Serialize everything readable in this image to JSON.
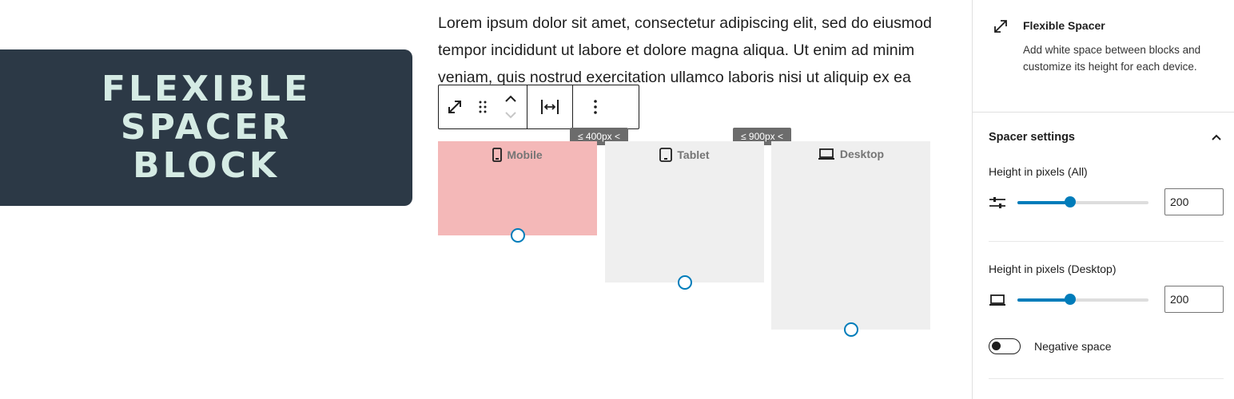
{
  "banner": {
    "title": "FLEXIBLE SPACER BLOCK"
  },
  "paragraph": {
    "text": "Lorem ipsum dolor sit amet, consectetur adipiscing elit, sed do eiusmod tempor incididunt ut labore et dolore magna aliqua. Ut enim ad minim veniam, quis nostrud exercitation ullamco laboris nisi ut aliquip ex ea commodo consequat."
  },
  "toolbar": {
    "buttons": [
      "resize-icon",
      "drag-handle-icon",
      "move-up-icon",
      "move-down-icon",
      "justify-icon",
      "more-options-icon"
    ]
  },
  "breakpoints": {
    "mobile": "≤ 400px <",
    "tablet": "≤ 900px <"
  },
  "previews": {
    "mobile": {
      "label": "Mobile",
      "icon": "mobile-icon",
      "color": "#f4b8b8"
    },
    "tablet": {
      "label": "Tablet",
      "icon": "tablet-icon",
      "color": "#efefef"
    },
    "desktop": {
      "label": "Desktop",
      "icon": "desktop-icon",
      "color": "#efefef"
    }
  },
  "sidebar": {
    "block": {
      "name": "Flexible Spacer",
      "description": "Add white space between blocks and customize its height for each device.",
      "icon": "resize-icon"
    },
    "panel": {
      "title": "Spacer settings",
      "fields": [
        {
          "label": "Height in pixels (All)",
          "value": "200",
          "level": 0.4,
          "icon": "sliders-icon"
        },
        {
          "label": "Height in pixels (Desktop)",
          "value": "200",
          "level": 0.4,
          "icon": "desktop-icon"
        }
      ],
      "toggle": {
        "label": "Negative space",
        "checked": false
      }
    }
  },
  "colors": {
    "accent": "#007cba",
    "banner_bg": "#2c3946",
    "banner_text": "#d5ebe4"
  }
}
